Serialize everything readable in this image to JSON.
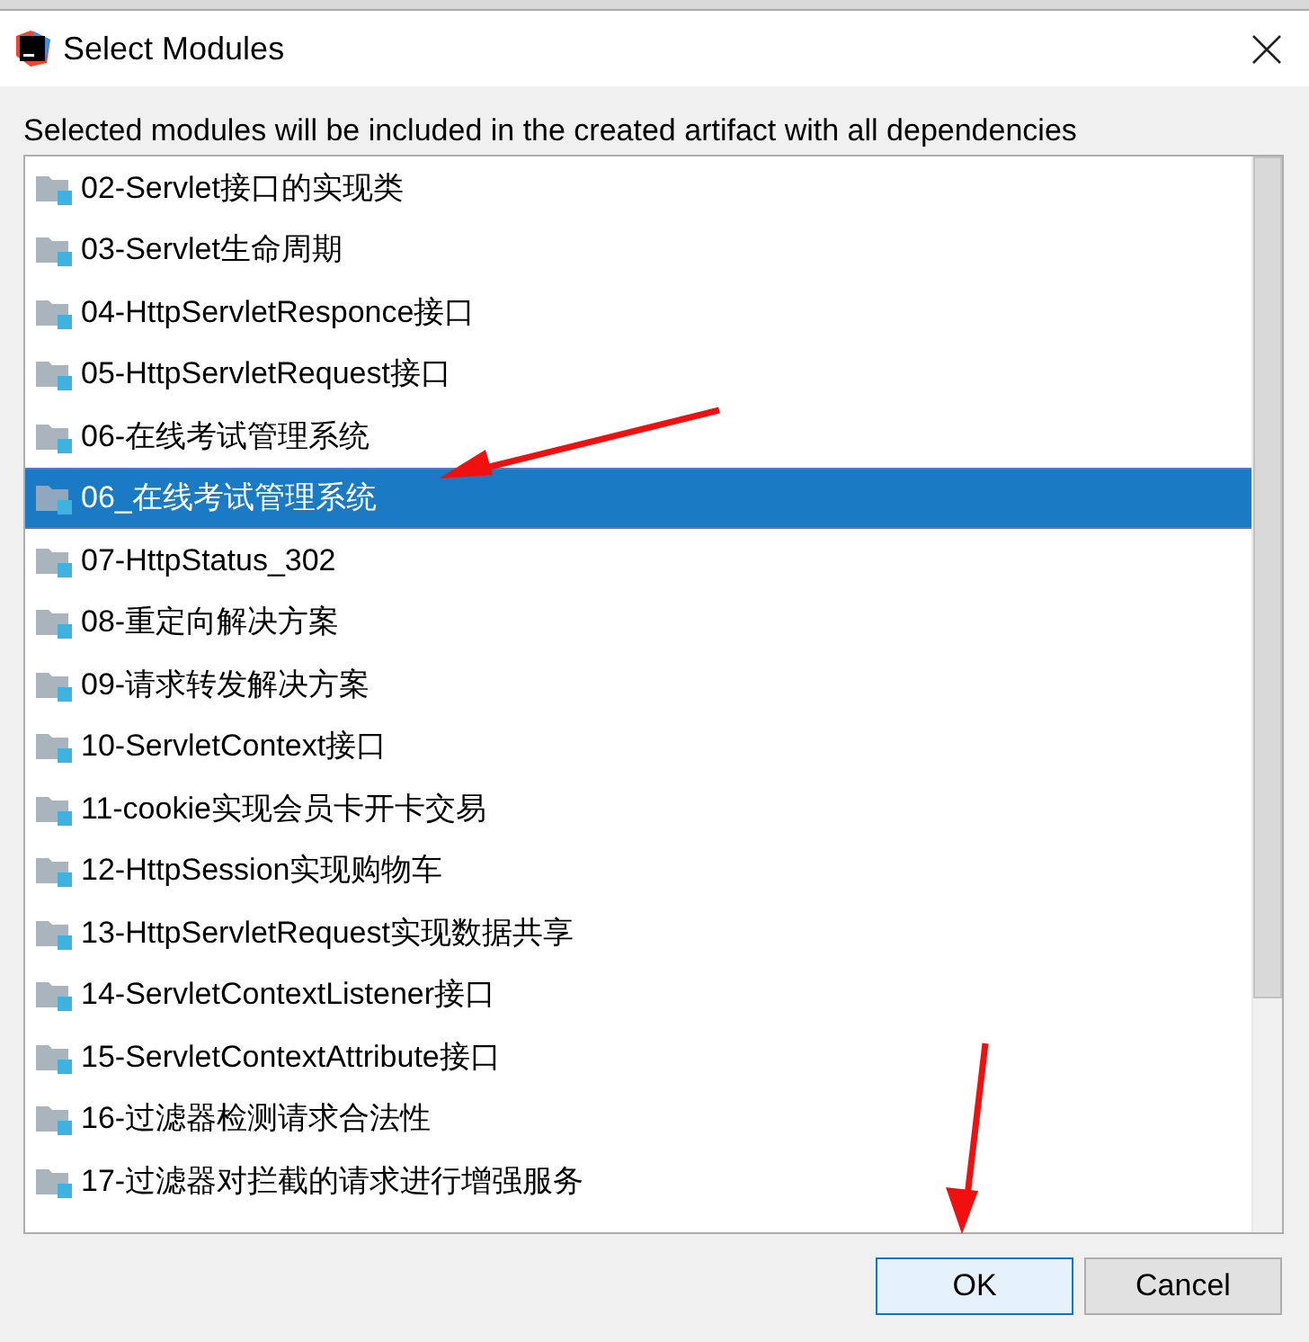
{
  "window": {
    "title": "Select Modules"
  },
  "description": "Selected modules will be included in the created artifact with all dependencies",
  "modules": [
    {
      "label": "02-Servlet接口的实现类",
      "selected": false
    },
    {
      "label": "03-Servlet生命周期",
      "selected": false
    },
    {
      "label": "04-HttpServletResponce接口",
      "selected": false
    },
    {
      "label": "05-HttpServletRequest接口",
      "selected": false
    },
    {
      "label": "06-在线考试管理系统",
      "selected": false
    },
    {
      "label": "06_在线考试管理系统",
      "selected": true
    },
    {
      "label": "07-HttpStatus_302",
      "selected": false
    },
    {
      "label": "08-重定向解决方案",
      "selected": false
    },
    {
      "label": "09-请求转发解决方案",
      "selected": false
    },
    {
      "label": "10-ServletContext接口",
      "selected": false
    },
    {
      "label": "11-cookie实现会员卡开卡交易",
      "selected": false
    },
    {
      "label": "12-HttpSession实现购物车",
      "selected": false
    },
    {
      "label": "13-HttpServletRequest实现数据共享",
      "selected": false
    },
    {
      "label": "14-ServletContextListener接口",
      "selected": false
    },
    {
      "label": "15-ServletContextAttribute接口",
      "selected": false
    },
    {
      "label": "16-过滤器检测请求合法性",
      "selected": false
    },
    {
      "label": "17-过滤器对拦截的请求进行增强服务",
      "selected": false
    }
  ],
  "buttons": [
    {
      "label": "OK",
      "kind": "default"
    },
    {
      "label": "Cancel",
      "kind": "normal"
    }
  ]
}
